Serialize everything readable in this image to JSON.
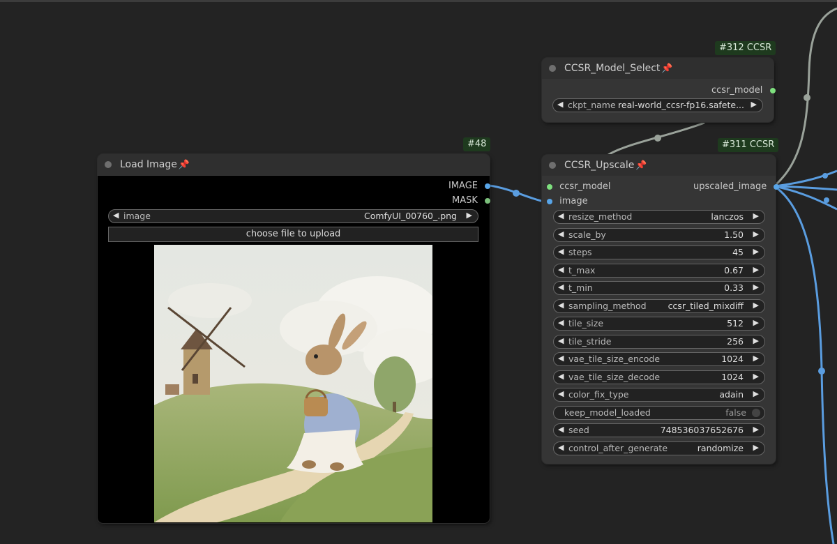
{
  "canvas": {
    "background": "#232323",
    "link_colors": {
      "image": "#5a9de0",
      "model": "#9aa29a"
    }
  },
  "load_image": {
    "badge": "#48",
    "title": "Load Image",
    "pin_icon": "📌",
    "outputs": [
      {
        "label": "IMAGE",
        "color": "#58a5e8"
      },
      {
        "label": "MASK",
        "color": "#7cc07c"
      }
    ],
    "image_widget": {
      "label": "image",
      "value": "ComfyUI_00760_.png"
    },
    "upload_label": "choose file to upload",
    "preview_description": "illustration of a rabbit in a dress with a basket walking on a path near a windmill"
  },
  "model_select": {
    "badge": "#312 CCSR",
    "title": "CCSR_Model_Select",
    "pin_icon": "📌",
    "output": "ccsr_model",
    "widget": {
      "label": "ckpt_name",
      "value": "real-world_ccsr-fp16.safete..."
    }
  },
  "upscale": {
    "badge": "#311 CCSR",
    "title": "CCSR_Upscale",
    "pin_icon": "📌",
    "inputs": [
      {
        "label": "ccsr_model",
        "color": "#7ee07e"
      },
      {
        "label": "image",
        "color": "#58a5e8"
      }
    ],
    "output": "upscaled_image",
    "widgets": [
      {
        "label": "resize_method",
        "value": "lanczos"
      },
      {
        "label": "scale_by",
        "value": "1.50"
      },
      {
        "label": "steps",
        "value": "45"
      },
      {
        "label": "t_max",
        "value": "0.67"
      },
      {
        "label": "t_min",
        "value": "0.33"
      },
      {
        "label": "sampling_method",
        "value": "ccsr_tiled_mixdiff"
      },
      {
        "label": "tile_size",
        "value": "512"
      },
      {
        "label": "tile_stride",
        "value": "256"
      },
      {
        "label": "vae_tile_size_encode",
        "value": "1024"
      },
      {
        "label": "vae_tile_size_decode",
        "value": "1024"
      },
      {
        "label": "color_fix_type",
        "value": "adain"
      },
      {
        "label": "keep_model_loaded",
        "value": "false",
        "toggle": true
      },
      {
        "label": "seed",
        "value": "748536037652676"
      },
      {
        "label": "control_after_generate",
        "value": "randomize"
      }
    ]
  }
}
